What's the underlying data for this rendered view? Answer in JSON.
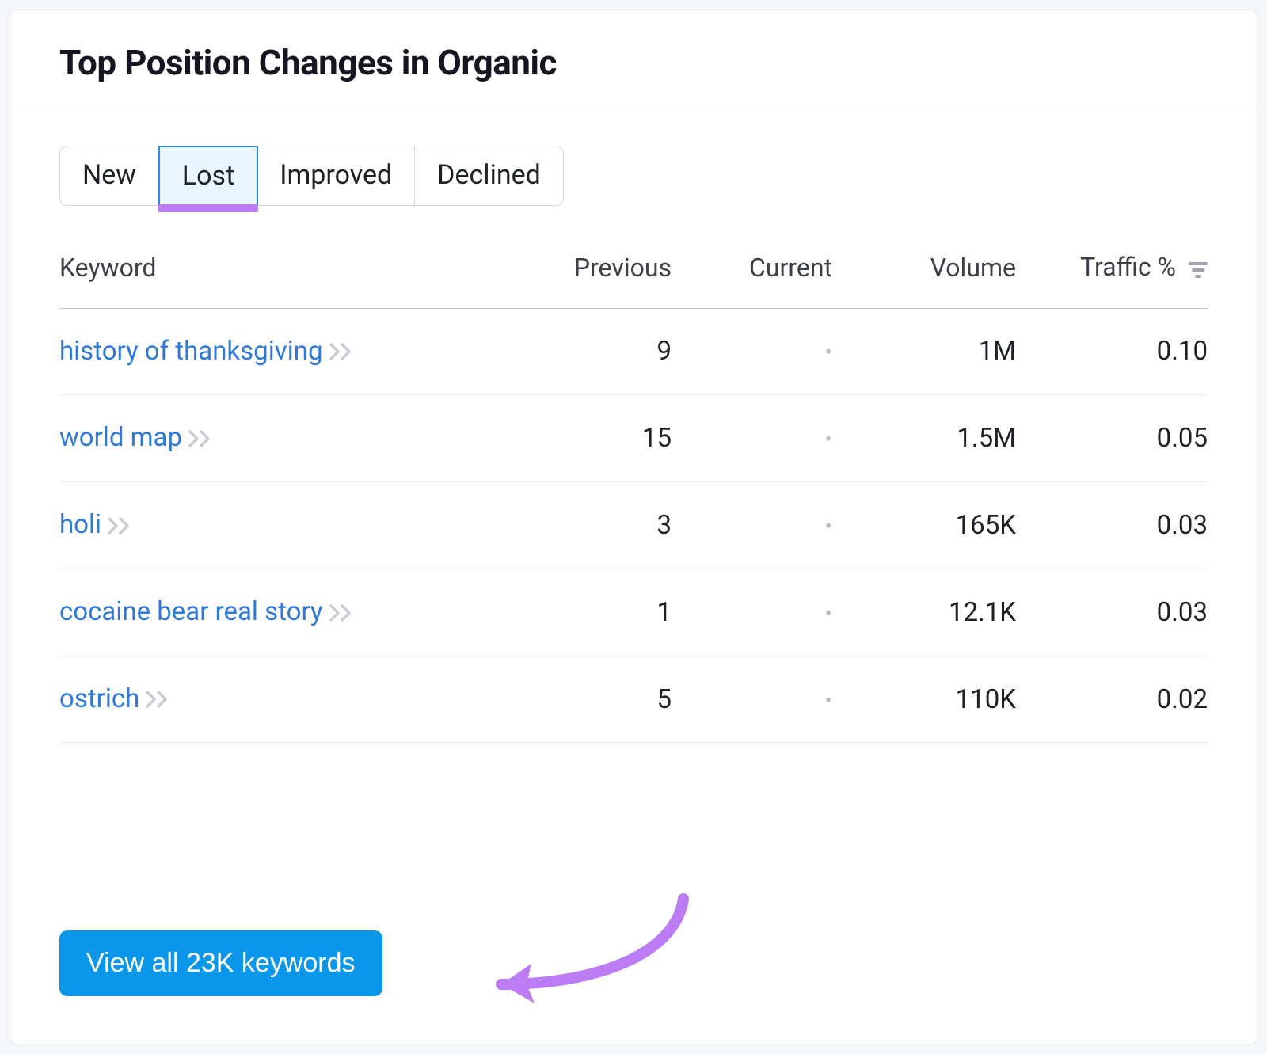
{
  "title": "Top Position Changes in Organic",
  "tabs": [
    {
      "label": "New",
      "active": false
    },
    {
      "label": "Lost",
      "active": true
    },
    {
      "label": "Improved",
      "active": false
    },
    {
      "label": "Declined",
      "active": false
    }
  ],
  "columns": {
    "keyword": "Keyword",
    "previous": "Previous",
    "current": "Current",
    "volume": "Volume",
    "traffic": "Traffic %"
  },
  "rows": [
    {
      "keyword": "history of thanksgiving",
      "previous": "9",
      "current": "•",
      "volume": "1M",
      "traffic": "0.10"
    },
    {
      "keyword": "world map",
      "previous": "15",
      "current": "•",
      "volume": "1.5M",
      "traffic": "0.05"
    },
    {
      "keyword": "holi",
      "previous": "3",
      "current": "•",
      "volume": "165K",
      "traffic": "0.03"
    },
    {
      "keyword": "cocaine bear real story",
      "previous": "1",
      "current": "•",
      "volume": "12.1K",
      "traffic": "0.03"
    },
    {
      "keyword": "ostrich",
      "previous": "5",
      "current": "•",
      "volume": "110K",
      "traffic": "0.02"
    }
  ],
  "cta": "View all 23K keywords"
}
